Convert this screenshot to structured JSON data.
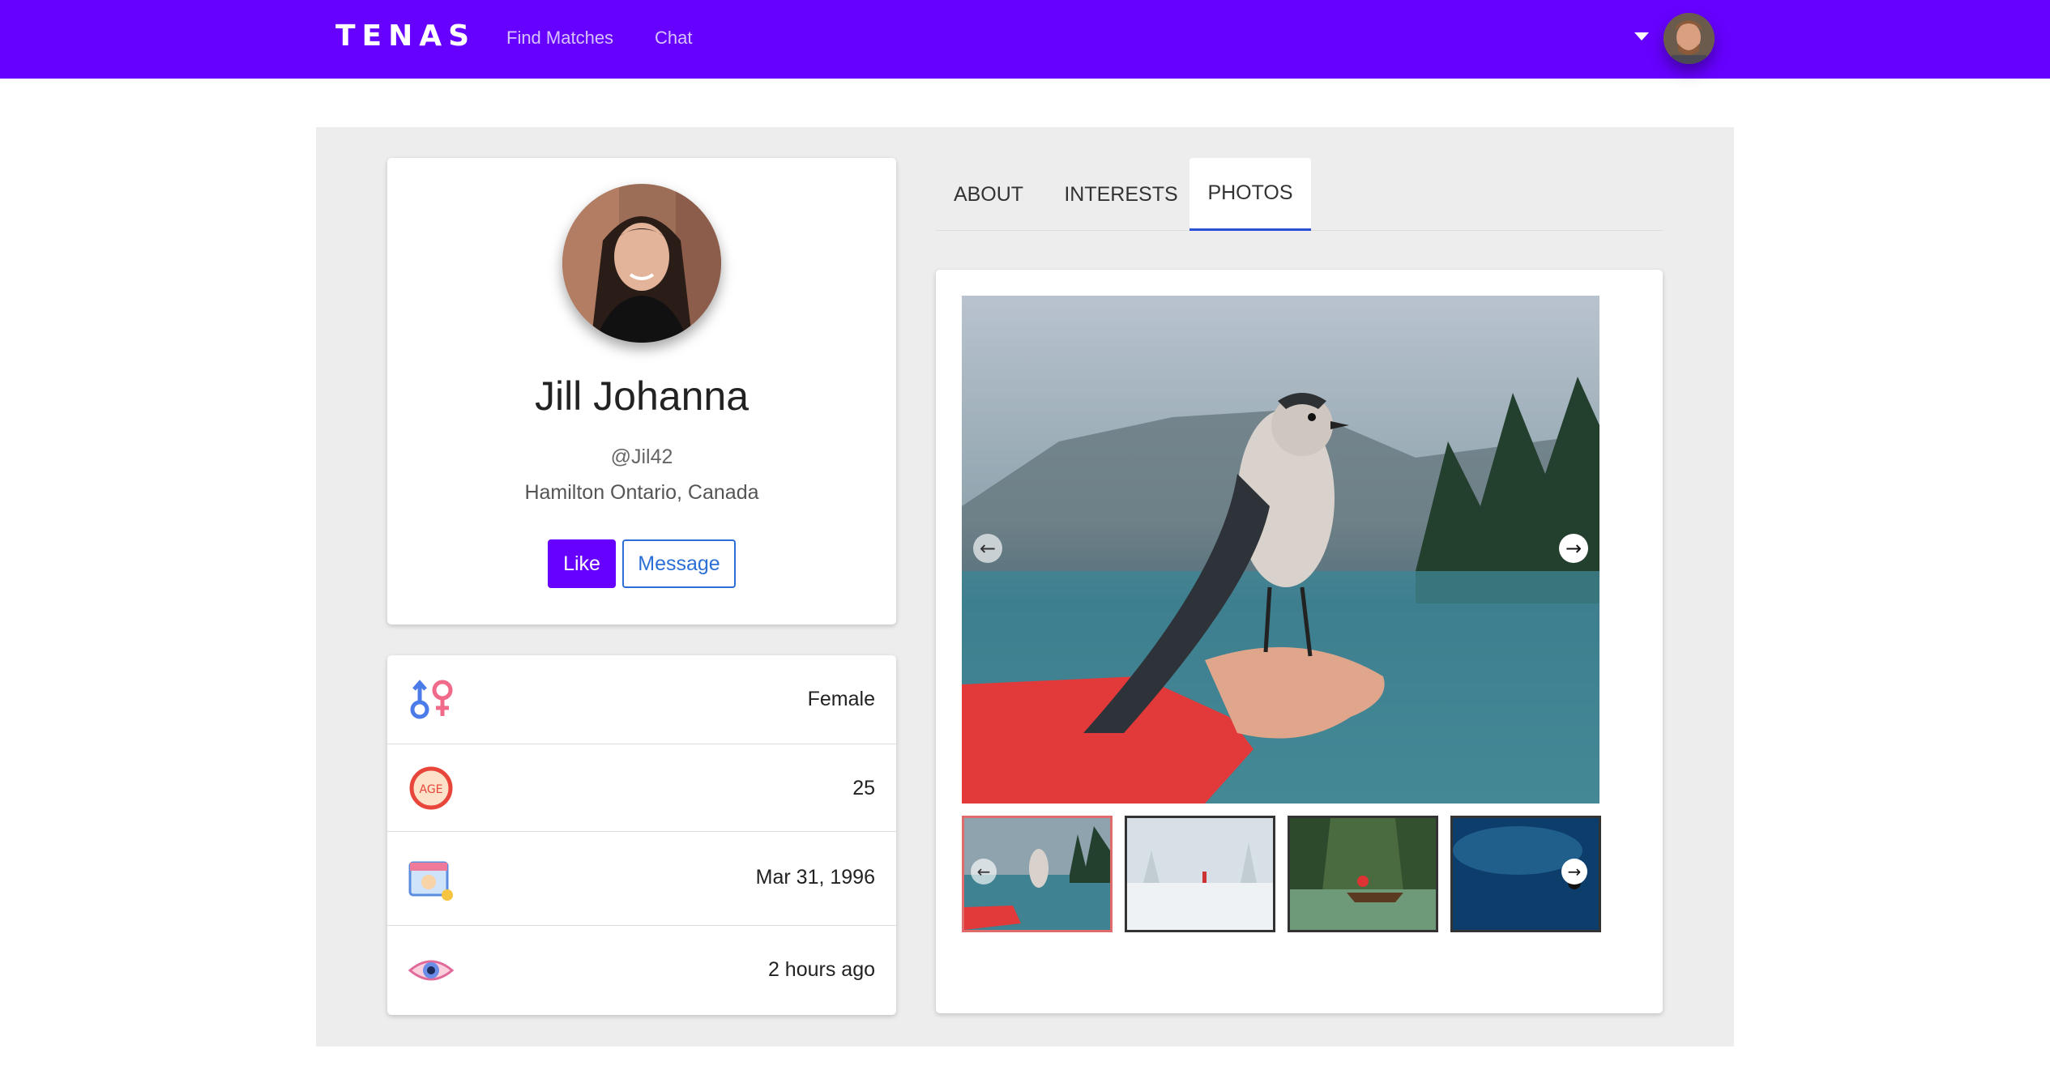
{
  "nav": {
    "brand": "TENAS",
    "links": [
      "Find Matches",
      "Chat"
    ]
  },
  "profile": {
    "name": "Jill Johanna",
    "handle": "@Jil42",
    "location": "Hamilton Ontario, Canada",
    "like_label": "Like",
    "message_label": "Message"
  },
  "stats": [
    {
      "icon": "gender-icon",
      "value": "Female"
    },
    {
      "icon": "age-icon",
      "value": "25"
    },
    {
      "icon": "birthday-calendar-icon",
      "value": "Mar 31, 1996"
    },
    {
      "icon": "eye-icon",
      "value": "2 hours ago"
    }
  ],
  "tabs": [
    "ABOUT",
    "INTERESTS",
    "PHOTOS"
  ],
  "active_tab": "PHOTOS",
  "photos": {
    "thumbnails": [
      "bird-on-hand",
      "snowy-landscape",
      "boat-on-river",
      "underwater-diver"
    ],
    "selected_index": 0
  },
  "colors": {
    "brand": "#6600ff",
    "link": "#2b6fd6",
    "panel_bg": "#ededed"
  }
}
